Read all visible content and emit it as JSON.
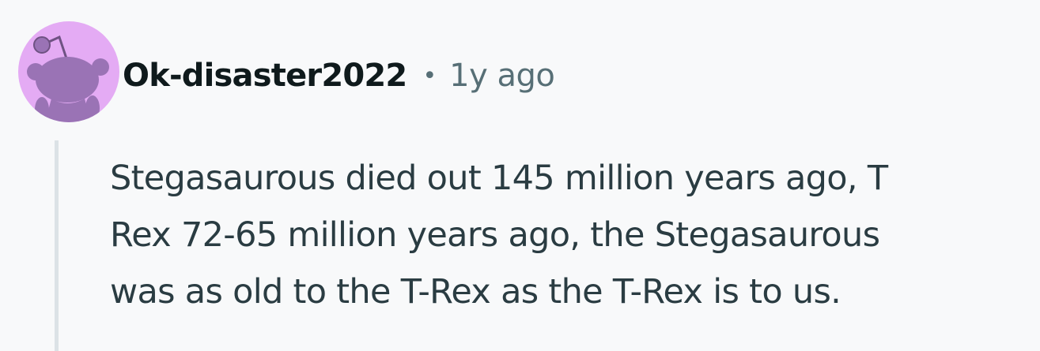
{
  "comment": {
    "avatar_icon": "reddit-snoo-avatar-icon",
    "avatar_bg": "#e4abf4",
    "avatar_fg": "#9a73b5",
    "username": "Ok-disaster2022",
    "separator": "•",
    "timestamp": "1y ago",
    "body_lines": [
      "Stegasaurous died out 145 million years ago, T",
      "Rex 72-65 million years ago, the Stegasaurous",
      "was as old to the T-Rex as the T-Rex is to us."
    ]
  }
}
